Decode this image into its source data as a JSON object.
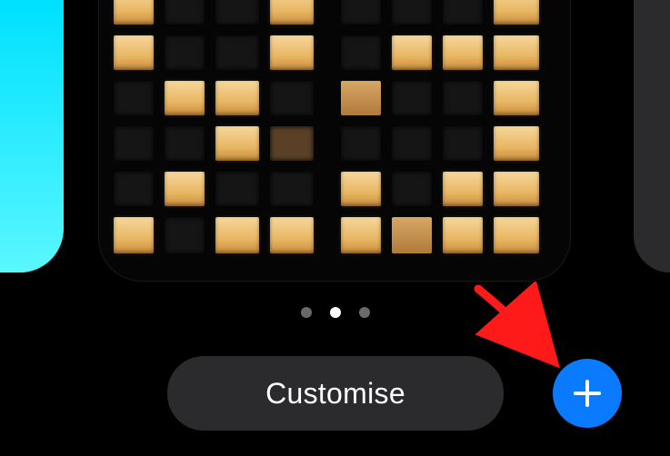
{
  "carousel": {
    "page_count": 3,
    "active_index": 1
  },
  "buttons": {
    "customise_label": "Customise",
    "add_label": "Add",
    "add_color": "#0a7aff"
  },
  "icons": {
    "plus": "plus-icon",
    "arrow": "annotation-arrow"
  },
  "annotation": {
    "arrow_color": "#ff1a1a",
    "points_to": "add-button"
  },
  "wallpapers": {
    "left_peek_color": "#00e1ff",
    "right_peek_color": "#2b2b2d",
    "center_description": "Night building facade with lit and dark windows"
  }
}
